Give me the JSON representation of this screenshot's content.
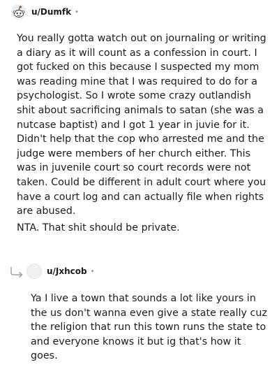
{
  "comments": [
    {
      "author": "u/Dumfk",
      "separator": "•",
      "avatar_icon": "reddit-snoo-avatar-icon",
      "paragraphs": [
        "You really gotta watch out on journaling or writing a diary as it will count as a confession in court. I got fucked on this because I suspected my mom was reading mine that I was required to do for a psychologist. So I wrote some crazy outlandish shit about sacrificing animals to satan (she was a nutcase baptist) and I got 1 year in juvie for it. Didn't help that the cop who arrested me and the judge were members of her church either. This was in juvenile court so court records were not taken. Could be different in adult court where you have a court log and can actually file when rights are abused.",
        "NTA. That shit should be private."
      ]
    },
    {
      "author": "u/Jxhcob",
      "separator": "•",
      "avatar_icon": "default-avatar-icon",
      "reply_icon": "reply-arrow-icon",
      "paragraphs": [
        "Ya I live a town that sounds a lot like yours in the us don't wanna even give a state really cuz the religion that run this town runs the state to and everyone knows it but ig that's how it goes."
      ]
    }
  ]
}
